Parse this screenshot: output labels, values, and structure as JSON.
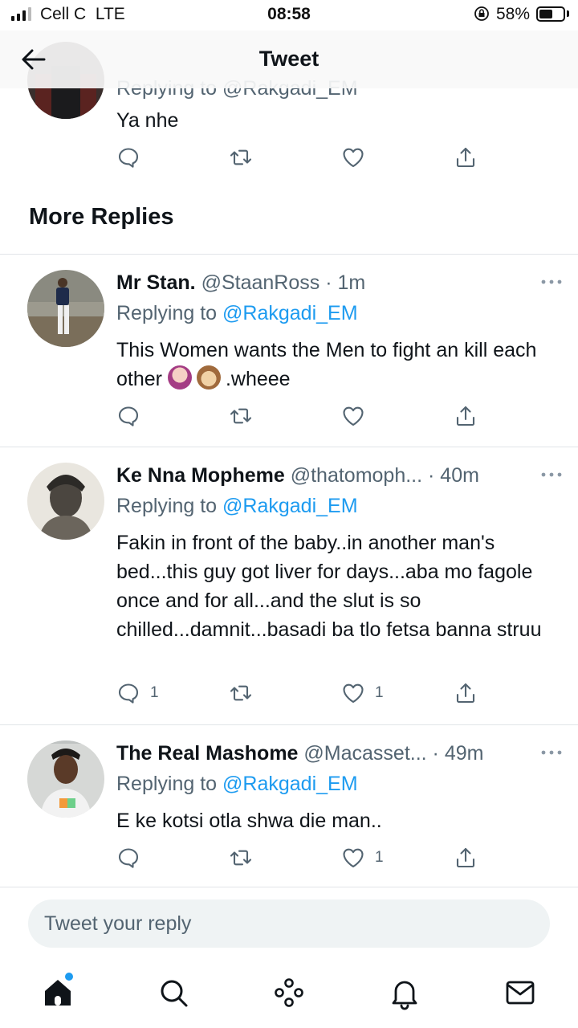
{
  "status_bar": {
    "carrier": "Cell C",
    "network": "LTE",
    "time": "08:58",
    "battery_percent": "58%",
    "battery_level": 0.58
  },
  "nav": {
    "title": "Tweet"
  },
  "prev_tweet": {
    "replying_partial": "Replying to @Rakgadi_EM",
    "text": "Ya nhe"
  },
  "section": {
    "title": "More Replies"
  },
  "replies": [
    {
      "name": "Mr Stan.",
      "handle": "@StaanRoss",
      "sep": " · ",
      "time": "1m",
      "replying_label": "Replying to",
      "replying_to": "@Rakgadi_EM",
      "text_a": "This Women wants the Men to fight an kill each other ",
      "text_b": ".wheee",
      "emojis": [
        "woman-gesturing-no",
        "see-no-evil-monkey"
      ],
      "reply_count": "",
      "like_count": ""
    },
    {
      "name": "Ke Nna Mopheme",
      "handle": "@thatomoph...",
      "sep": " · ",
      "time": "40m",
      "replying_label": "Replying to",
      "replying_to": "@Rakgadi_EM",
      "text": "Fakin in front of the baby..in another man's bed...this guy got liver for days...aba mo fagole once and for all...and the slut is so chilled...damnit...basadi ba tlo fetsa banna struu",
      "reply_count": "1",
      "like_count": "1"
    },
    {
      "name": "The Real Mashome",
      "handle": "@Macasset...",
      "sep": " · ",
      "time": "49m",
      "replying_label": "Replying to",
      "replying_to": "@Rakgadi_EM",
      "text": "E ke kotsi otla shwa die man..",
      "reply_count": "",
      "like_count": "1"
    }
  ],
  "composer": {
    "placeholder": "Tweet your reply"
  },
  "tabbar": {
    "items": [
      "home-icon",
      "search-icon",
      "spaces-icon",
      "notifications-icon",
      "messages-icon"
    ]
  },
  "colors": {
    "accent": "#1d9bf0",
    "text": "#0f1419",
    "secondary": "#536471",
    "divider": "#e1e5e8"
  }
}
